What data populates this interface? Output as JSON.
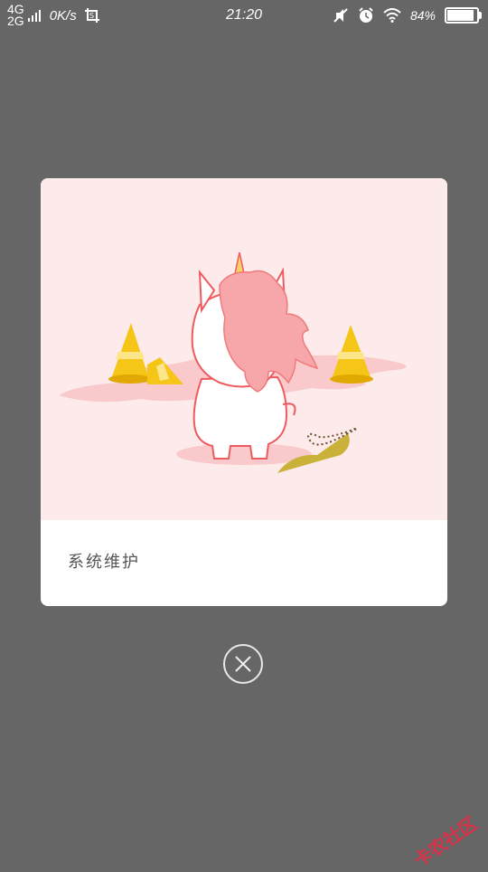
{
  "status_bar": {
    "network_top": "4G",
    "network_bottom": "2G",
    "speed": "0K/s",
    "time": "21:20",
    "battery_text": "84%",
    "battery_level": 0.84,
    "icons": [
      "signal-bars-icon",
      "screenshot-icon",
      "mute-icon",
      "alarm-icon",
      "wifi-icon",
      "battery-icon"
    ]
  },
  "dialog": {
    "message": "系统维护",
    "illustration": "unicorn-maintenance-illustration"
  },
  "close_button": {
    "icon": "close-icon"
  },
  "watermark": {
    "text": "卡农社区"
  },
  "colors": {
    "overlay": "#666666",
    "card_top": "#fdebeb",
    "cone": "#f5c518",
    "mane": "#f7a7a9"
  }
}
